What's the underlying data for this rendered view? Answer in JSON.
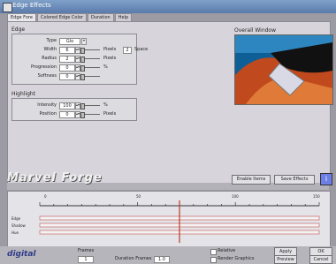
{
  "window": {
    "title": "Edge Effects"
  },
  "tabs": [
    "Edge Fore",
    "Colored Edge Color",
    "Duration",
    "Help"
  ],
  "edge": {
    "title": "Edge",
    "rows": [
      {
        "label": "Type",
        "value": "Glo",
        "unit": ""
      },
      {
        "label": "Width",
        "value": "6",
        "unit": "Pixels"
      },
      {
        "label": "Radius",
        "value": "2",
        "unit": "Pixels"
      },
      {
        "label": "Progression",
        "value": "0",
        "unit": "%"
      },
      {
        "label": "Softness",
        "value": "0",
        "unit": ""
      }
    ],
    "extra_value": "2",
    "extra_unit": "Space"
  },
  "highlight": {
    "title": "Highlight",
    "rows": [
      {
        "label": "Intensity",
        "value": "100",
        "unit": "%"
      },
      {
        "label": "Position",
        "value": "0",
        "unit": "Pixels"
      }
    ]
  },
  "preview": {
    "label": "Overall Window"
  },
  "brand": "Marvel Forge",
  "buttons": {
    "reset": "Enable Items",
    "save": "Save Effects"
  },
  "timeline": {
    "ticks": [
      "0",
      "50",
      "100",
      "150"
    ],
    "rows": [
      "Edge",
      "Shadow",
      "Hue"
    ],
    "progress": 0.5
  },
  "bottom": {
    "logo": "digital",
    "frames_label": "Frames",
    "frames_value": "1",
    "duration_label": "Duration Frames",
    "duration_value": "1.0",
    "options": [
      "Relative",
      "Render Graphics"
    ],
    "actions": [
      "Apply",
      "Preview",
      "OK",
      "Cancel"
    ]
  }
}
